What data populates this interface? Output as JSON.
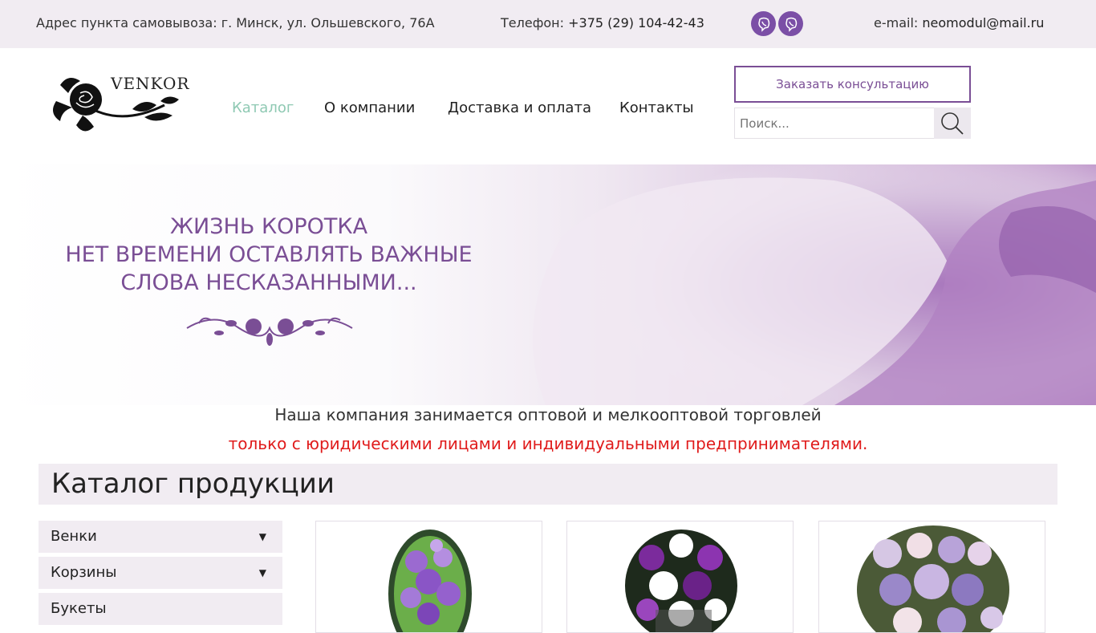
{
  "topbar": {
    "address": "Адрес пункта самовывоза: г. Минск, ул. Ольшевского, 76А",
    "phone_label": "Телефон:",
    "phone": "+375 (29) 104-42-43",
    "email_label": "e-mail:",
    "email": "neomodul@mail.ru",
    "messenger_icons": [
      "viber-icon",
      "viber-icon"
    ]
  },
  "header": {
    "logo_text": "VENKOR",
    "nav": [
      {
        "label": "Каталог",
        "active": true
      },
      {
        "label": "О компании",
        "active": false
      },
      {
        "label": "Доставка и оплата",
        "active": false
      },
      {
        "label": "Контакты",
        "active": false
      }
    ],
    "consult_button": "Заказать консультацию",
    "search_placeholder": "Поиск..."
  },
  "hero": {
    "lines": [
      "ЖИЗНЬ КОРОТКА",
      "НЕТ ВРЕМЕНИ ОСТАВЛЯТЬ ВАЖНЫЕ",
      "СЛОВА НЕСКАЗАННЫМИ..."
    ]
  },
  "notice": {
    "line1": "Наша компания занимается оптовой и мелкооптовой торговлей",
    "line2": "только с юридическими лицами и индивидуальными предпринимателями."
  },
  "catalog": {
    "title": "Каталог продукции",
    "categories": [
      {
        "label": "Венки",
        "expandable": true
      },
      {
        "label": "Корзины",
        "expandable": true
      },
      {
        "label": "Букеты",
        "expandable": false
      }
    ],
    "products": [
      "wreath-image",
      "basket-image",
      "bouquet-image"
    ]
  },
  "colors": {
    "accent": "#7a4e95",
    "nav_active": "#8fc9b3",
    "warning": "#e01b1b",
    "panel_bg": "#f1ecf2"
  }
}
